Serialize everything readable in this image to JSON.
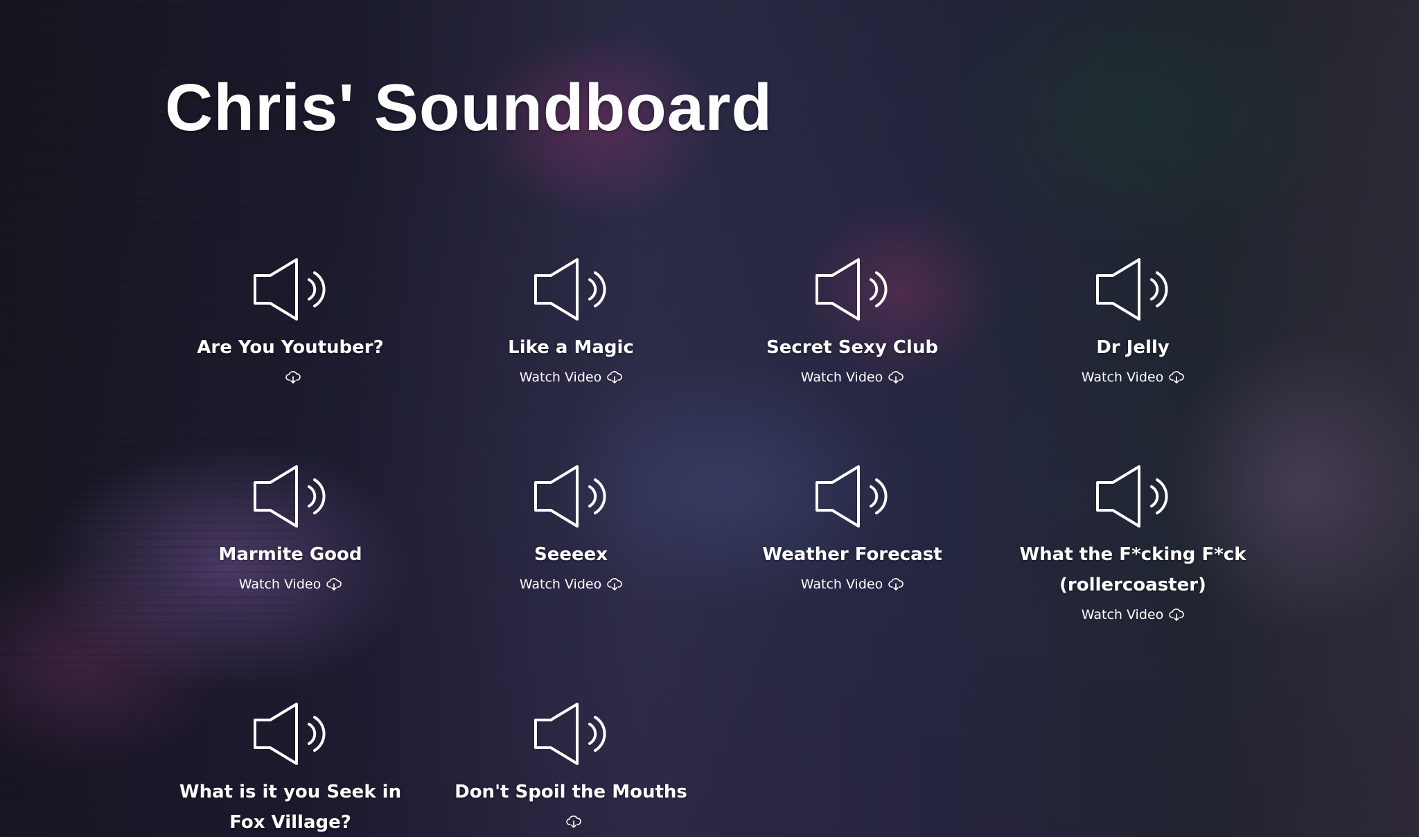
{
  "page": {
    "title": "Chris' Soundboard"
  },
  "sounds": [
    {
      "title": "Are You Youtuber?",
      "link_label": ""
    },
    {
      "title": "Like a Magic",
      "link_label": "Watch Video"
    },
    {
      "title": "Secret Sexy Club",
      "link_label": "Watch Video"
    },
    {
      "title": "Dr Jelly",
      "link_label": "Watch Video"
    },
    {
      "title": "Marmite Good",
      "link_label": "Watch Video"
    },
    {
      "title": "Seeeex",
      "link_label": "Watch Video"
    },
    {
      "title": "Weather Forecast",
      "link_label": "Watch Video"
    },
    {
      "title": "What the F*cking F*ck (rollercoaster)",
      "link_label": "Watch Video"
    },
    {
      "title": "What is it you Seek in Fox Village?",
      "link_label": ""
    },
    {
      "title": "Don't Spoil the Mouths",
      "link_label": ""
    }
  ],
  "icons": {
    "sound": "speaker-icon",
    "download": "cloud-download-icon"
  },
  "colors": {
    "text": "#ffffff"
  }
}
